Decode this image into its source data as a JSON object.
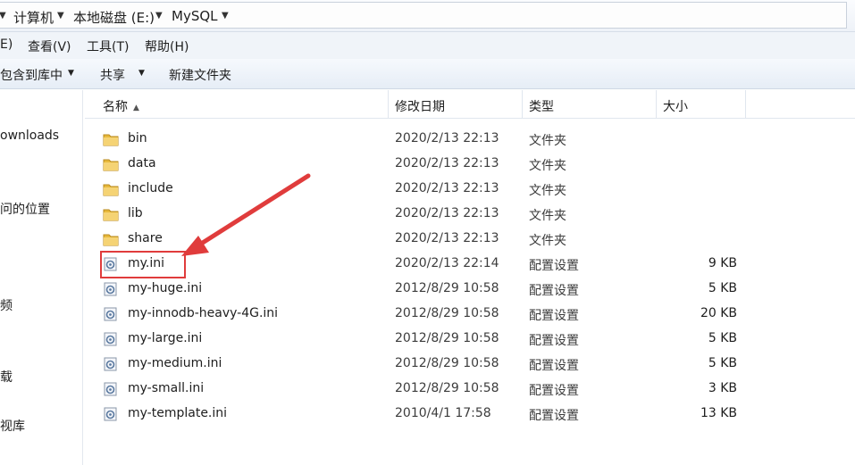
{
  "address_bar": {
    "crumbs": [
      "计算机",
      "本地磁盘 (E:)",
      "MySQL"
    ]
  },
  "menu": {
    "items": [
      "E)",
      "查看(V)",
      "工具(T)",
      "帮助(H)"
    ]
  },
  "toolbar": {
    "include_label": "包含到库中",
    "share_label": "共享",
    "new_folder_label": "新建文件夹"
  },
  "nav": {
    "items": [
      "ownloads",
      "问的位置",
      "频",
      "载",
      "视库"
    ]
  },
  "columns": {
    "name": "名称",
    "modified": "修改日期",
    "type": "类型",
    "size": "大小"
  },
  "files": [
    {
      "name": "bin",
      "modified": "2020/2/13 22:13",
      "type": "文件夹",
      "size": "",
      "icon": "folder-icon"
    },
    {
      "name": "data",
      "modified": "2020/2/13 22:13",
      "type": "文件夹",
      "size": "",
      "icon": "folder-icon"
    },
    {
      "name": "include",
      "modified": "2020/2/13 22:13",
      "type": "文件夹",
      "size": "",
      "icon": "folder-icon"
    },
    {
      "name": "lib",
      "modified": "2020/2/13 22:13",
      "type": "文件夹",
      "size": "",
      "icon": "folder-icon"
    },
    {
      "name": "share",
      "modified": "2020/2/13 22:13",
      "type": "文件夹",
      "size": "",
      "icon": "folder-icon"
    },
    {
      "name": "my.ini",
      "modified": "2020/2/13 22:14",
      "type": "配置设置",
      "size": "9 KB",
      "icon": "config-file-icon"
    },
    {
      "name": "my-huge.ini",
      "modified": "2012/8/29 10:58",
      "type": "配置设置",
      "size": "5 KB",
      "icon": "config-file-icon"
    },
    {
      "name": "my-innodb-heavy-4G.ini",
      "modified": "2012/8/29 10:58",
      "type": "配置设置",
      "size": "20 KB",
      "icon": "config-file-icon"
    },
    {
      "name": "my-large.ini",
      "modified": "2012/8/29 10:58",
      "type": "配置设置",
      "size": "5 KB",
      "icon": "config-file-icon"
    },
    {
      "name": "my-medium.ini",
      "modified": "2012/8/29 10:58",
      "type": "配置设置",
      "size": "5 KB",
      "icon": "config-file-icon"
    },
    {
      "name": "my-small.ini",
      "modified": "2012/8/29 10:58",
      "type": "配置设置",
      "size": "3 KB",
      "icon": "config-file-icon"
    },
    {
      "name": "my-template.ini",
      "modified": "2010/4/1 17:58",
      "type": "配置设置",
      "size": "13 KB",
      "icon": "config-file-icon"
    }
  ],
  "colors": {
    "annotation": "#e03c3c",
    "folder": "#e8b93c"
  }
}
